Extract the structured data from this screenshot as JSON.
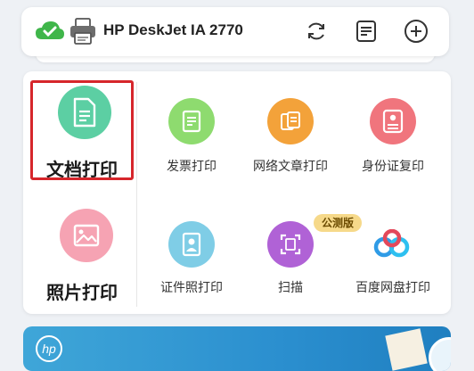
{
  "header": {
    "printer_name": "HP DeskJet IA 2770",
    "icons": [
      "cloud-check-icon",
      "printer-icon",
      "refresh-icon",
      "document-list-icon",
      "add-icon"
    ]
  },
  "tiles": {
    "doc_print": "文档打印",
    "photo_print": "照片打印",
    "invoice_print": "发票打印",
    "web_article_print": "网络文章打印",
    "id_copy_print": "身份证复印",
    "id_photo_print": "证件照打印",
    "scan": "扫描",
    "baidu_pan_print": "百度网盘打印"
  },
  "badge": {
    "beta": "公测版"
  },
  "colors": {
    "doc": "#5ccfa3",
    "photo": "#f6a3b3",
    "invoice": "#8edb6f",
    "web": "#f3a23a",
    "idcopy": "#f0757d",
    "idphoto": "#7fcde6",
    "scan": "#b062d6",
    "highlight": "#d6262b"
  }
}
